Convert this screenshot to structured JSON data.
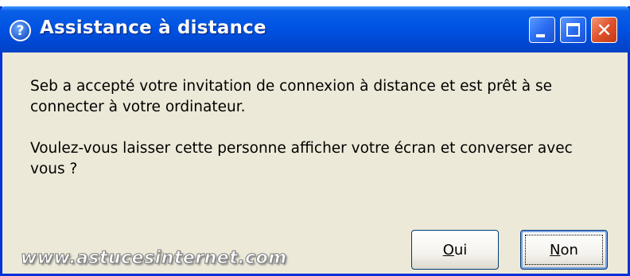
{
  "window": {
    "title": "Assistance à distance",
    "help_icon_glyph": "?",
    "controls": {
      "minimize": "minimize-icon",
      "maximize": "maximize-icon",
      "close": "close-icon",
      "close_glyph": "✕"
    }
  },
  "message": {
    "paragraph1": "Seb a accepté votre invitation de connexion à distance et est prêt à se connecter à votre ordinateur.",
    "paragraph2": "Voulez-vous laisser cette personne afficher votre écran et converser avec vous ?"
  },
  "buttons": {
    "yes": {
      "mnemonic": "O",
      "rest": "ui"
    },
    "no": {
      "mnemonic": "N",
      "rest": "on"
    }
  },
  "watermark": "www.astucesinternet.com",
  "colors": {
    "titlebar": "#0054e3",
    "window_bg": "#ece9d8",
    "close_button": "#e0522c",
    "button_border": "#003c74"
  }
}
